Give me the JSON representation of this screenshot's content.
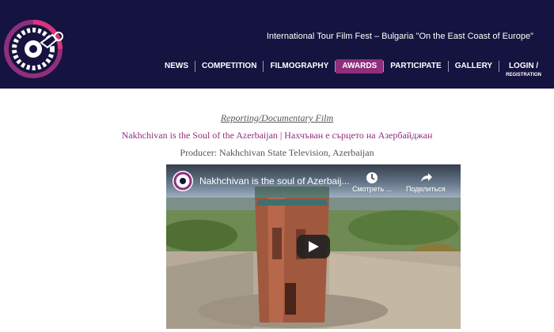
{
  "header": {
    "site_title": "International Tour Film Fest – Bulgaria \"On the East Coast of Europe\"",
    "nav": [
      {
        "label": "NEWS"
      },
      {
        "label": "COMPETITION"
      },
      {
        "label": "FILMOGRAPHY"
      },
      {
        "label": "AWARDS",
        "active": true
      },
      {
        "label": "PARTICIPATE"
      },
      {
        "label": "GALLERY"
      },
      {
        "label": "LOGIN /",
        "sub": "REGISTRATION"
      }
    ]
  },
  "content": {
    "category": "Reporting/Documentary Film",
    "film_title": "Nakhchivan is the Soul of the Azerbaijan | Нахчъван е сърцето на Азербайджан",
    "producer": "Producer: Nakhchivan State Television, Azerbaijan"
  },
  "video": {
    "title": "Nakhchivan is the soul of Azerbaij...",
    "watch_later": "Смотреть ...",
    "share": "Поделиться"
  },
  "colors": {
    "header_bg": "#15133f",
    "accent": "#8f2f7b"
  }
}
